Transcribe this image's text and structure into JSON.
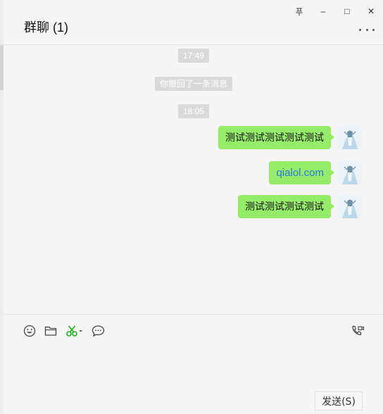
{
  "window": {
    "title": "群聊 (1)",
    "controls": {
      "pin": "푸",
      "minimize": "–",
      "maximize": "□",
      "close": "✕"
    }
  },
  "chat": {
    "time1": "17:49",
    "recall_notice": "你撤回了一条消息",
    "time2": "18:05",
    "messages": [
      {
        "text": "测试测试测试测试测试",
        "type": "text"
      },
      {
        "text": "qialol.com",
        "type": "link"
      },
      {
        "text": "测试测试测试测试",
        "type": "text"
      }
    ]
  },
  "toolbar": {
    "icons": [
      "emoji-icon",
      "folder-icon",
      "scissors-icon",
      "chat-bubble-icon",
      "video-call-icon"
    ]
  },
  "composer": {
    "value": "",
    "send_label": "发送(S)"
  },
  "colors": {
    "bubble": "#95ec69",
    "link": "#2a78d6",
    "background": "#f5f5f5",
    "scissors": "#1aad19"
  }
}
